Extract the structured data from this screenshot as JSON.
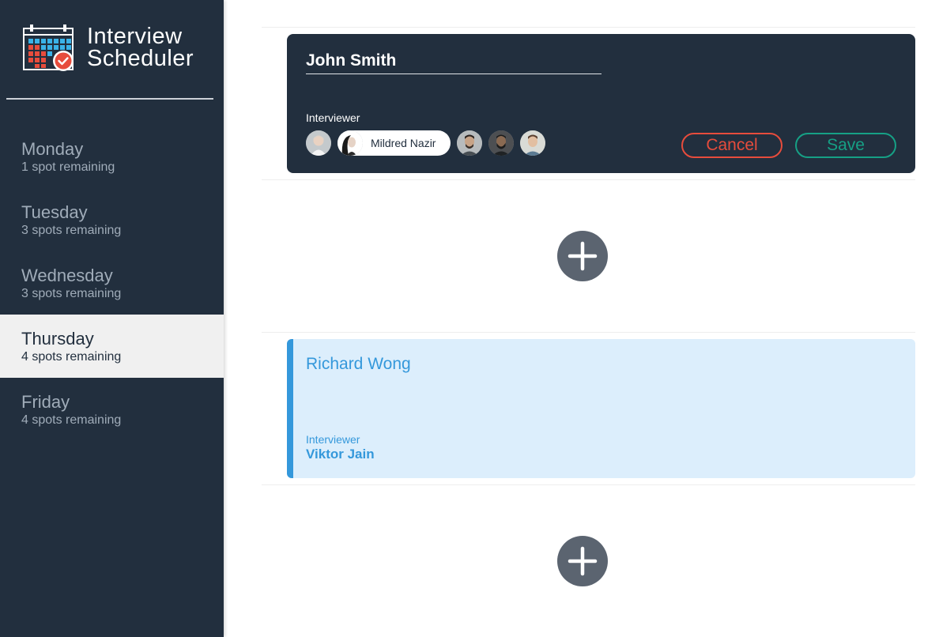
{
  "app": {
    "title_line1": "Interview",
    "title_line2": "Scheduler",
    "logo_icon": "calendar-check-icon"
  },
  "sidebar": {
    "days": [
      {
        "name": "Monday",
        "spots": "1 spot remaining",
        "selected": false
      },
      {
        "name": "Tuesday",
        "spots": "3 spots remaining",
        "selected": false
      },
      {
        "name": "Wednesday",
        "spots": "3 spots remaining",
        "selected": false
      },
      {
        "name": "Thursday",
        "spots": "4 spots remaining",
        "selected": true
      },
      {
        "name": "Friday",
        "spots": "4 spots remaining",
        "selected": false
      }
    ]
  },
  "form": {
    "student_name": "John Smith",
    "interviewer_label": "Interviewer",
    "selected_interviewer": "Mildred Nazir",
    "cancel_label": "Cancel",
    "save_label": "Save"
  },
  "appointment": {
    "student_name": "Richard Wong",
    "interviewer_label": "Interviewer",
    "interviewer_name": "Viktor Jain"
  },
  "actions": {
    "add_icon": "plus-icon"
  },
  "colors": {
    "sidebar_bg": "#222f3e",
    "danger": "#e74c3c",
    "success": "#16a085",
    "info": "#3498db",
    "info_bg": "#dceefc",
    "add_button": "#5b6470"
  }
}
